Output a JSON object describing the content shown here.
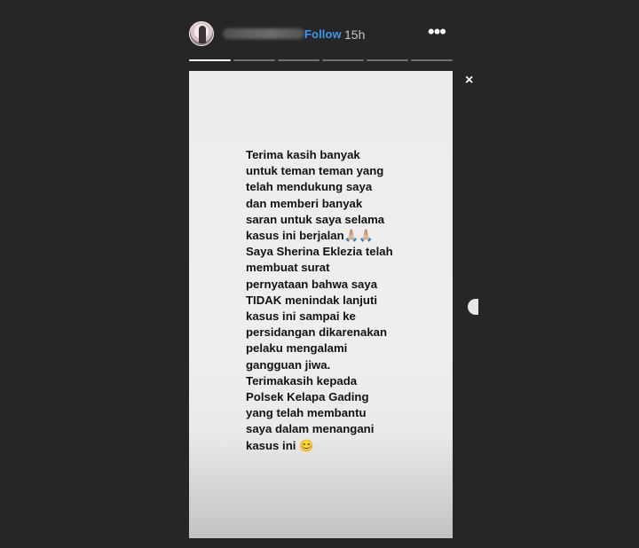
{
  "header": {
    "avatar_icon": "profile-avatar-icon",
    "username": "",
    "follow_label": "Follow",
    "timestamp": "15h",
    "more_icon": "more-options-icon",
    "more_label": "•••"
  },
  "progress": {
    "segments": [
      1,
      0,
      0,
      0,
      0,
      0
    ]
  },
  "story": {
    "text": "Terima kasih banyak\nuntuk teman teman yang\ntelah mendukung saya\ndan memberi banyak\nsaran untuk saya selama\nkasus ini berjalan🙏🏼🙏🏼\nSaya Sherina Eklezia telah\nmembuat surat\npernyataan bahwa saya\nTIDAK menindak lanjuti\nkasus ini sampai ke\npersidangan dikarenakan\npelaku mengalami\ngangguan jiwa.\nTerimakasih kepada\nPolsek Kelapa Gading\nyang telah membantu\nsaya dalam menangani\nkasus ini 😊"
  },
  "controls": {
    "close_icon": "close-icon",
    "close_label": "×",
    "next_icon": "next-story-arrow-icon"
  },
  "colors": {
    "background": "#262626",
    "follow": "#3897f0",
    "story_bg": "#eeeeee",
    "story_text": "#121212"
  }
}
